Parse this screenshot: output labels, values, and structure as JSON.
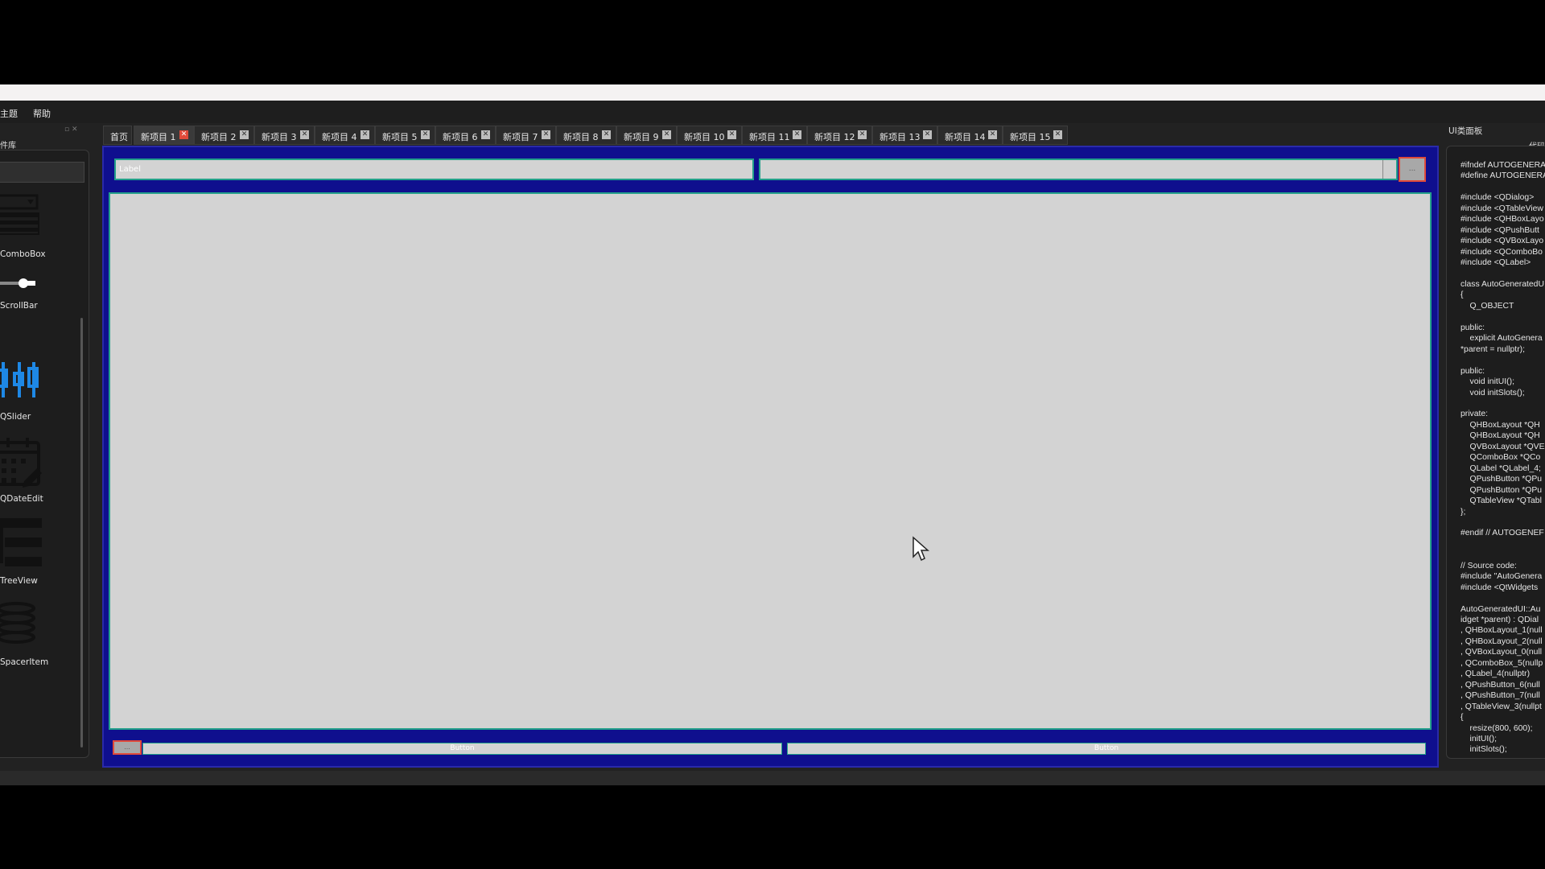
{
  "menubar": {
    "item_theme": "主题",
    "item_help": "帮助"
  },
  "left_panel": {
    "header": "件库",
    "dock_buttons": "▫ ✕",
    "widgets": [
      "ComboBox",
      "ScrollBar",
      "QSlider",
      "QDateEdit",
      "TreeView",
      "SpacerItem"
    ]
  },
  "tabs": [
    "首页",
    "新项目 1",
    "新项目 2",
    "新项目 3",
    "新项目 4",
    "新项目 5",
    "新项目 6",
    "新项目 7",
    "新项目 8",
    "新项目 9",
    "新项目 10",
    "新项目 11",
    "新项目 12",
    "新项目 13",
    "新项目 14",
    "新项目 15"
  ],
  "active_tab": "新项目 1",
  "canvas": {
    "label_text": "Label",
    "top_button": "...",
    "small_button": "...",
    "bottom_button_left": "Button",
    "bottom_button_right": "Button"
  },
  "right_panel": {
    "title": "UI类面板",
    "subtitle": "代码",
    "code": "#ifndef AUTOGENERA\n#define AUTOGENERA\n\n#include <QDialog>\n#include <QTableView\n#include <QHBoxLayo\n#include <QPushButt\n#include <QVBoxLayo\n#include <QComboBo\n#include <QLabel>\n\nclass AutoGeneratedU\n{\n    Q_OBJECT\n\npublic:\n    explicit AutoGenera\n*parent = nullptr);\n\npublic:\n    void initUI();\n    void initSlots();\n\nprivate:\n    QHBoxLayout *QH\n    QHBoxLayout *QH\n    QVBoxLayout *QVE\n    QComboBox *QCo\n    QLabel *QLabel_4;\n    QPushButton *QPu\n    QPushButton *QPu\n    QTableView *QTabl\n};\n\n#endif // AUTOGENEF\n\n\n// Source code:\n#include \"AutoGenera\n#include <QtWidgets\n\nAutoGeneratedUI::Au\nidget *parent) : QDial\n, QHBoxLayout_1(null\n, QHBoxLayout_2(null\n, QVBoxLayout_0(null\n, QComboBox_5(nullp\n, QLabel_4(nullptr)\n, QPushButton_6(null\n, QPushButton_7(null\n, QTableView_3(nullpt\n{\n    resize(800, 600);\n    initUI();\n    initSlots();"
  },
  "icons": [
    "combobox-icon",
    "scrollbar-icon",
    "slider-icon",
    "date-edit-icon",
    "tree-view-icon",
    "spacer-icon",
    "tab-close-icon",
    "mouse-cursor-icon"
  ],
  "colors": {
    "canvas_frame": "#0f0f8e",
    "widget_border": "#23a08a",
    "selected_button_border": "#e04a3a",
    "widget_fill": "#d3d3d3"
  }
}
